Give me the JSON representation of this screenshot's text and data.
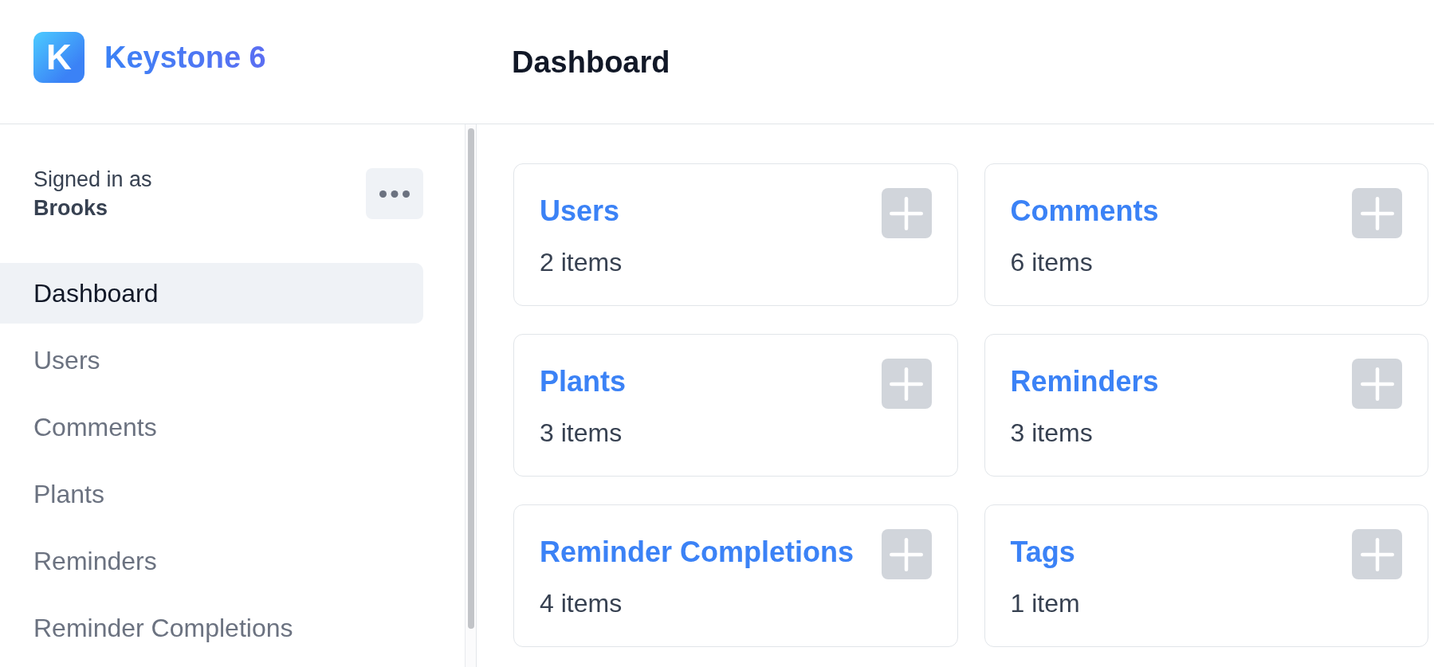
{
  "header": {
    "logo": {
      "letter": "K",
      "name": "Keystone 6"
    },
    "title": "Dashboard"
  },
  "sidebar": {
    "signed_in_label": "Signed in as",
    "user_name": "Brooks",
    "items": [
      {
        "label": "Dashboard",
        "selected": true
      },
      {
        "label": "Users",
        "selected": false
      },
      {
        "label": "Comments",
        "selected": false
      },
      {
        "label": "Plants",
        "selected": false
      },
      {
        "label": "Reminders",
        "selected": false
      },
      {
        "label": "Reminder Completions",
        "selected": false
      }
    ]
  },
  "cards": [
    {
      "title": "Users",
      "count": "2 items"
    },
    {
      "title": "Comments",
      "count": "6 items"
    },
    {
      "title": "Plants",
      "count": "3 items"
    },
    {
      "title": "Reminders",
      "count": "3 items"
    },
    {
      "title": "Reminder Completions",
      "count": "4 items"
    },
    {
      "title": "Tags",
      "count": "1 item"
    }
  ]
}
